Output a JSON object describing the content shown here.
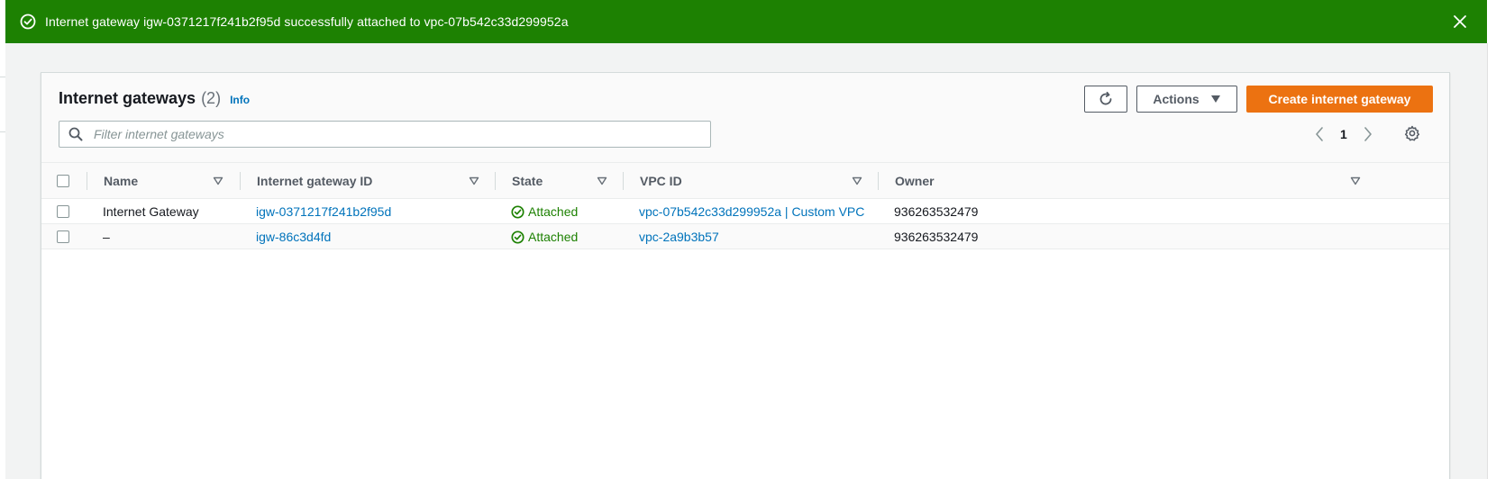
{
  "flash": {
    "message": "Internet gateway igw-0371217f241b2f95d successfully attached to vpc-07b542c33d299952a",
    "color": "#1d8102"
  },
  "header": {
    "title": "Internet gateways",
    "count": "(2)",
    "info_label": "Info",
    "actions_label": "Actions",
    "create_label": "Create internet gateway",
    "create_color": "#ec7211"
  },
  "search": {
    "placeholder": "Filter internet gateways",
    "value": ""
  },
  "pagination": {
    "current_page": "1"
  },
  "table": {
    "columns": [
      "Name",
      "Internet gateway ID",
      "State",
      "VPC ID",
      "Owner"
    ],
    "rows": [
      {
        "name": "Internet Gateway",
        "gateway_id": "igw-0371217f241b2f95d",
        "state": "Attached",
        "vpc_id": "vpc-07b542c33d299952a | Custom VPC",
        "owner": "936263532479"
      },
      {
        "name": "–",
        "gateway_id": "igw-86c3d4fd",
        "state": "Attached",
        "vpc_id": "vpc-2a9b3b57",
        "owner": "936263532479"
      }
    ]
  },
  "icons": {
    "flash": "success-icon",
    "close": "close-icon",
    "refresh": "refresh-icon",
    "caret": "caret-down-icon",
    "search": "search-icon",
    "prev": "chevron-left-icon",
    "next": "chevron-right-icon",
    "settings": "gear-icon",
    "sort": "sort-icon",
    "state": "status-positive-icon"
  }
}
